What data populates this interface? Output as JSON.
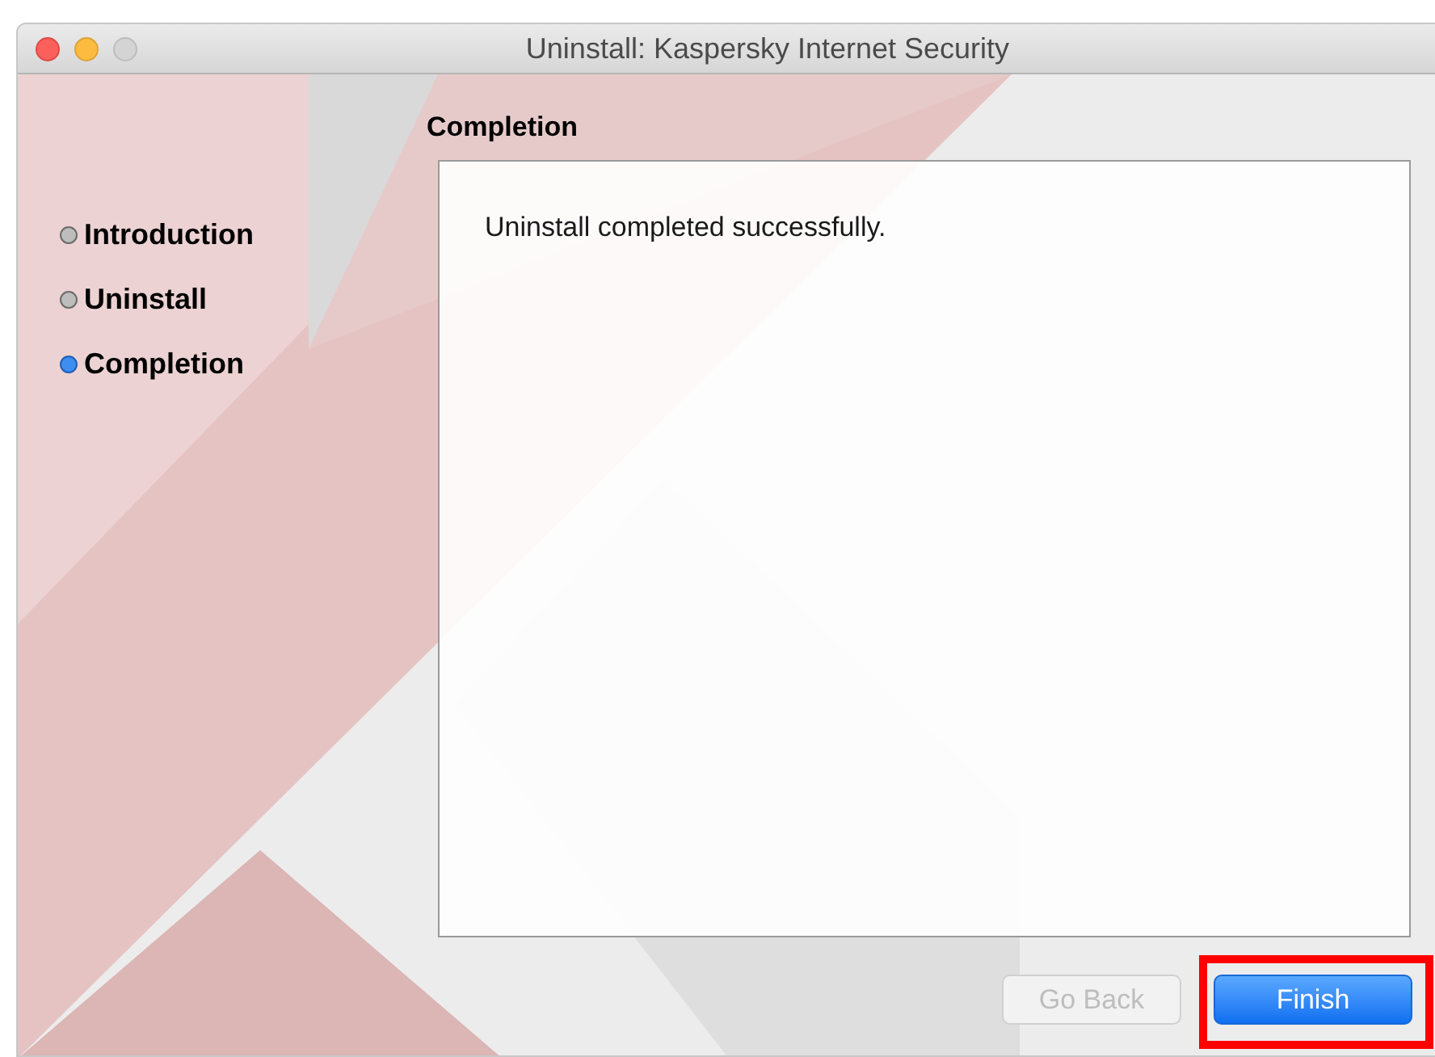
{
  "window": {
    "title": "Uninstall: Kaspersky Internet Security"
  },
  "steps": [
    {
      "label": "Introduction",
      "selected": false
    },
    {
      "label": "Uninstall",
      "selected": false
    },
    {
      "label": "Completion",
      "selected": true
    }
  ],
  "page_title": "Completion",
  "message": "Uninstall completed successfully.",
  "buttons": [
    {
      "label": "Go Back",
      "disabled": true,
      "highlighted": false
    },
    {
      "label": "Finish",
      "disabled": false,
      "highlighted": true
    }
  ]
}
